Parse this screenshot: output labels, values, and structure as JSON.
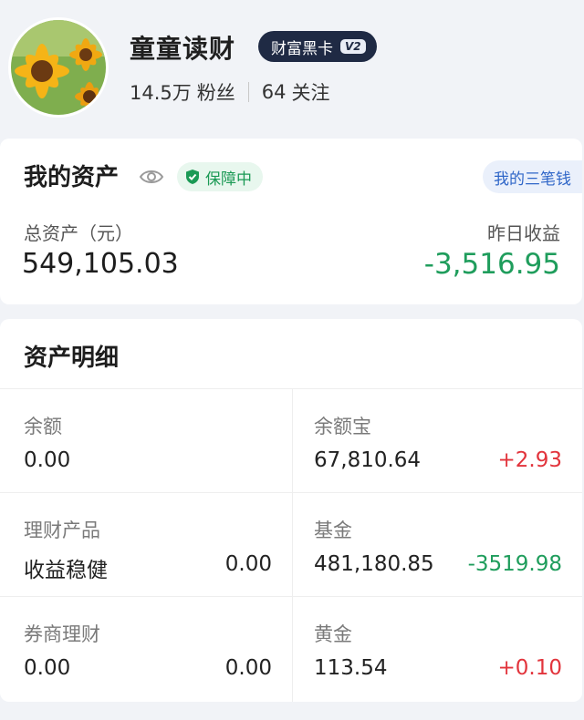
{
  "profile": {
    "avatar_icon": "sunflower-avatar",
    "username": "童童读财",
    "badge_label": "财富黑卡",
    "badge_level": "V2",
    "fans_count": "14.5万",
    "fans_label": "粉丝",
    "follow_count": "64",
    "follow_label": "关注"
  },
  "summary": {
    "title": "我的资产",
    "eye_icon": "eye-icon",
    "protect_label": "保障中",
    "three_money_label": "我的三笔钱",
    "total_label": "总资产（元）",
    "total_value": "549,105.03",
    "yesterday_label": "昨日收益",
    "yesterday_value": "-3,516.95"
  },
  "detail": {
    "title": "资产明细",
    "cells": [
      {
        "label": "余额",
        "value": "0.00",
        "right": ""
      },
      {
        "label": "余额宝",
        "value": "67,810.64",
        "right": "+2.93"
      },
      {
        "label": "理财产品",
        "value": "收益稳健",
        "right": "0.00"
      },
      {
        "label": "基金",
        "value": "481,180.85",
        "right": "-3519.98"
      },
      {
        "label": "券商理财",
        "value": "0.00",
        "right": "0.00"
      },
      {
        "label": "黄金",
        "value": "113.54",
        "right": "+0.10"
      }
    ]
  },
  "colors": {
    "gain": "#e2343c",
    "loss": "#1f9d5c",
    "badge_bg": "#1f2a44",
    "accent_blue": "#2f66c8"
  }
}
